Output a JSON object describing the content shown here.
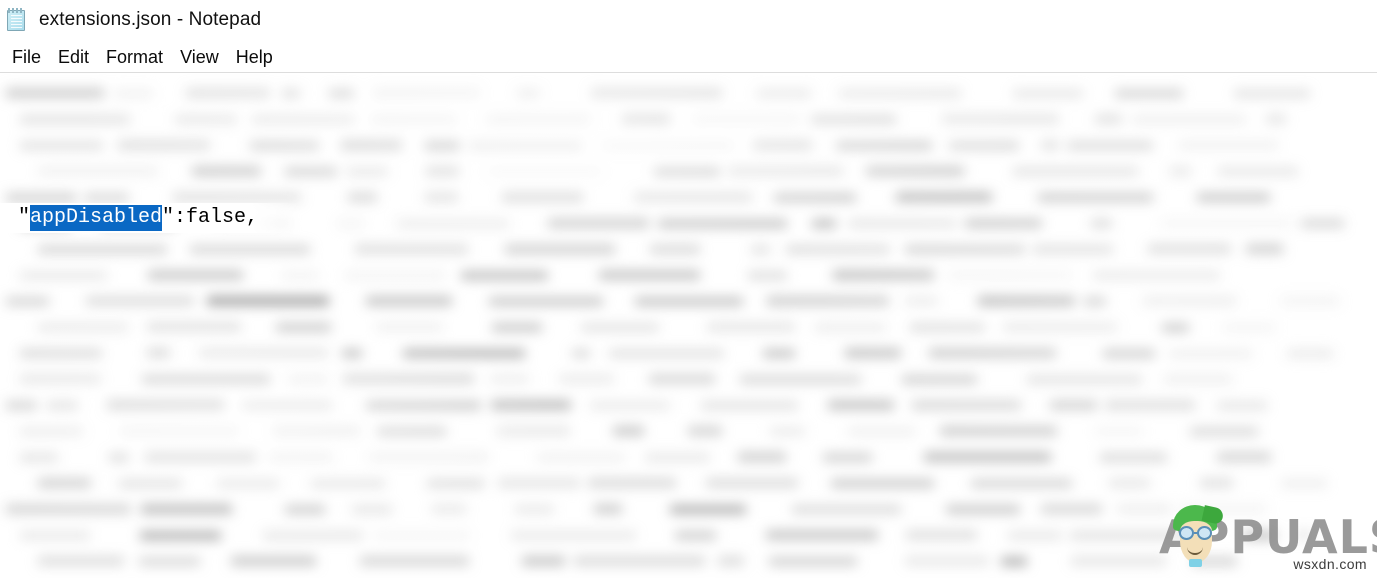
{
  "window": {
    "icon": "notepad-icon",
    "title": "extensions.json - Notepad"
  },
  "menubar": {
    "items": [
      {
        "label": "File"
      },
      {
        "label": "Edit"
      },
      {
        "label": "Format"
      },
      {
        "label": "View"
      },
      {
        "label": "Help"
      }
    ]
  },
  "document": {
    "focused_line": {
      "quote_open": "\"",
      "selected_key": "appDisabled",
      "after_key": "\":false,"
    },
    "selection_color": "#0a68c4",
    "selection_text_color": "#ffffff",
    "background_color": "#ffffff",
    "text_color": "#000000",
    "note": "Remaining document body is blurred and illegible"
  },
  "watermark": {
    "brand": "APPUALS",
    "brand_prefix": "A",
    "brand_suffix": "PUALS",
    "url": "wsxdn.com",
    "brand_color": "#8d8d8d",
    "mascot_hair_color": "#4cb84c"
  }
}
